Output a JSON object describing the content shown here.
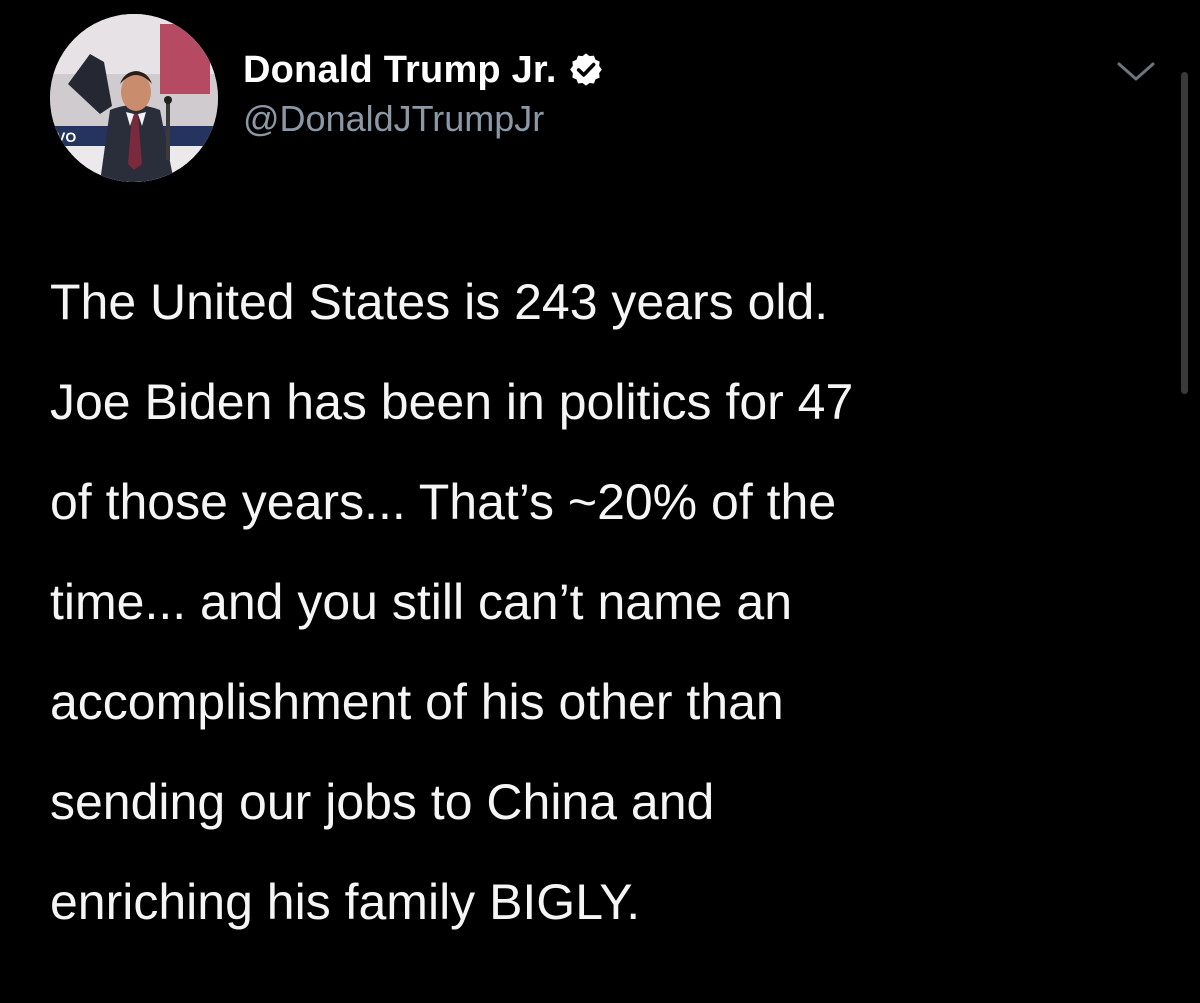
{
  "tweet": {
    "author": {
      "display_name": "Donald Trump Jr.",
      "handle": "@DonaldJTrumpJr",
      "verified": true
    },
    "text": "The United States is 243 years old.\nJoe Biden has been in politics for 47\nof those years... That’s ~20% of the\ntime... and you still can’t name an\naccomplishment of his other than\nsending our jobs to China and\nenriching his family BIGLY.",
    "icons": {
      "verified": "verified-badge-icon",
      "more": "chevron-down-icon",
      "avatar": "profile-photo"
    },
    "avatar_logo_text": "VO"
  },
  "theme": {
    "background": "#000000",
    "text": "#ffffff",
    "secondary_text": "#8b98a5"
  }
}
